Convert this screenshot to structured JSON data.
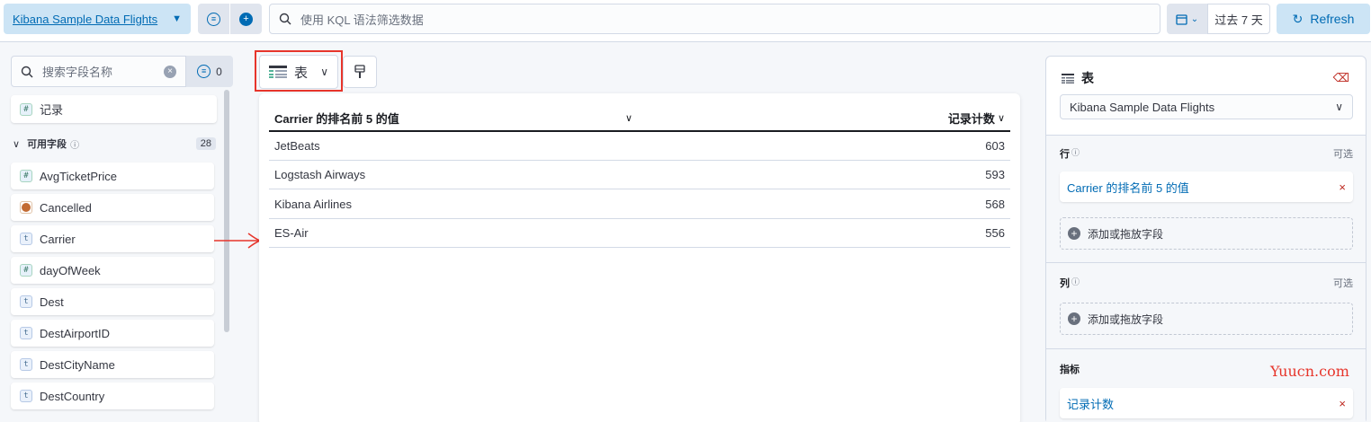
{
  "topbar": {
    "data_view": "Kibana Sample Data Flights",
    "search_placeholder": "使用 KQL 语法筛选数据",
    "date_range": "过去 7 天",
    "refresh_label": "Refresh"
  },
  "field_list": {
    "search_placeholder": "搜索字段名称",
    "filter_count": "0",
    "records_field": "记录",
    "available_label": "可用字段",
    "available_count": "28",
    "fields": [
      {
        "name": "AvgTicketPrice",
        "type": "number"
      },
      {
        "name": "Cancelled",
        "type": "boolean"
      },
      {
        "name": "Carrier",
        "type": "string"
      },
      {
        "name": "dayOfWeek",
        "type": "number"
      },
      {
        "name": "Dest",
        "type": "string"
      },
      {
        "name": "DestAirportID",
        "type": "string"
      },
      {
        "name": "DestCityName",
        "type": "string"
      },
      {
        "name": "DestCountry",
        "type": "string"
      }
    ]
  },
  "workspace": {
    "chart_type": "表",
    "table": {
      "col1": "Carrier 的排名前 5 的值",
      "col2": "记录计数",
      "rows": [
        {
          "name": "JetBeats",
          "value": "603"
        },
        {
          "name": "Logstash Airways",
          "value": "593"
        },
        {
          "name": "Kibana Airlines",
          "value": "568"
        },
        {
          "name": "ES-Air",
          "value": "556"
        }
      ]
    }
  },
  "config": {
    "title": "表",
    "data_view": "Kibana Sample Data Flights",
    "rows_label": "行",
    "optional": "可选",
    "rows_dimension": "Carrier 的排名前 5 的值",
    "add_field": "添加或拖放字段",
    "columns_label": "列",
    "metrics_label": "指标",
    "metrics_dimension": "记录计数"
  },
  "watermark": "Yuucn.com"
}
